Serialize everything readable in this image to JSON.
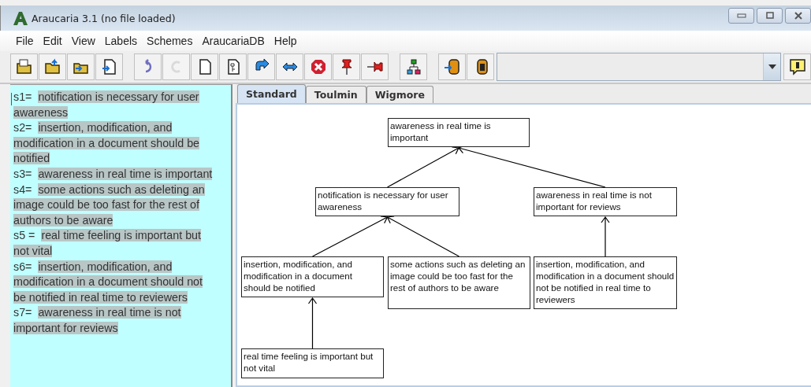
{
  "window": {
    "title": "Araucaria 3.1  (no file loaded)"
  },
  "menu": [
    {
      "label": "File"
    },
    {
      "label": "Edit"
    },
    {
      "label": "View"
    },
    {
      "label": "Labels"
    },
    {
      "label": "Schemes"
    },
    {
      "label": "AraucariaDB"
    },
    {
      "label": "Help"
    }
  ],
  "toolbar": [
    {
      "kind": "open",
      "disabled": false
    },
    {
      "kind": "open-up",
      "disabled": false
    },
    {
      "kind": "folder-in",
      "disabled": false
    },
    {
      "kind": "doc-in",
      "disabled": false
    },
    {
      "kind": "undo",
      "disabled": false
    },
    {
      "kind": "redo",
      "disabled": true
    },
    {
      "kind": "page",
      "disabled": false
    },
    {
      "kind": "tree-page",
      "disabled": false
    },
    {
      "kind": "turn",
      "disabled": false
    },
    {
      "kind": "swap",
      "disabled": false
    },
    {
      "kind": "delete",
      "disabled": false
    },
    {
      "kind": "pin",
      "disabled": false
    },
    {
      "kind": "pin-side",
      "disabled": false
    },
    {
      "kind": "tree",
      "disabled": false
    },
    {
      "kind": "db-in",
      "disabled": false
    },
    {
      "kind": "db-query",
      "disabled": false
    }
  ],
  "statements": [
    {
      "label": "s1=",
      "text": "notification is necessary for user awareness"
    },
    {
      "label": "s2=",
      "text": "insertion, modification, and modification in a document should be notified"
    },
    {
      "label": "s3=",
      "text": "awareness in real time is important"
    },
    {
      "label": "s4=",
      "text": "some actions such as deleting an image could be too fast for the rest of authors to be aware"
    },
    {
      "label": "s5 =",
      "text": "real time feeling is important but not vital"
    },
    {
      "label": "s6=",
      "text": "insertion, modification, and modification in a document should not be notified in real time to reviewers"
    },
    {
      "label": "s7=",
      "text": "awareness in real time is not important for reviews"
    }
  ],
  "tabs": [
    {
      "label": "Standard",
      "selected": true
    },
    {
      "label": "Toulmin",
      "selected": false
    },
    {
      "label": "Wigmore",
      "selected": false
    }
  ],
  "diagram": {
    "text": "awareness in real time is important",
    "children": [
      {
        "text": "notification is necessary for user awareness",
        "children": [
          {
            "text": "insertion, modification, and modification in a document should be notified",
            "children": [
              {
                "text": "real time feeling is important but not vital"
              }
            ]
          },
          {
            "text": "some actions such as deleting an image could be too fast for the rest of authors to be aware"
          }
        ]
      },
      {
        "text": "awareness in real time is not important for reviews",
        "children": [
          {
            "text": "insertion, modification, and modification in a document should not be notified in real time to reviewers"
          }
        ]
      }
    ]
  }
}
